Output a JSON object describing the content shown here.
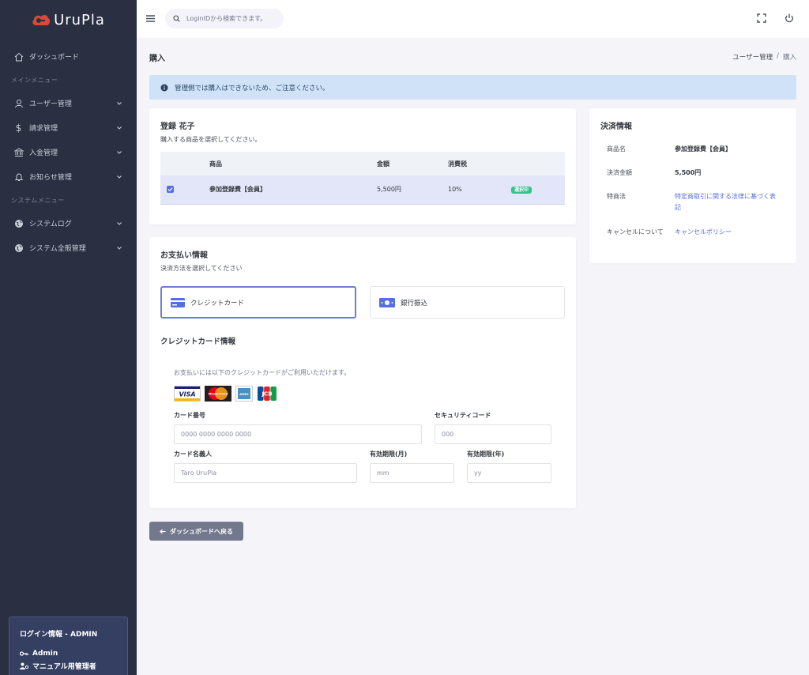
{
  "app": {
    "name": "UruPla",
    "brand_color": "#e0463a",
    "accent_color": "#556ee6"
  },
  "sidebar": {
    "dashboard": "ダッシュボード",
    "main_menu_label": "メインメニュー",
    "main_items": [
      {
        "label": "ユーザー管理",
        "icon": "user-icon"
      },
      {
        "label": "請求管理",
        "icon": "dollar-icon"
      },
      {
        "label": "入金管理",
        "icon": "bank-icon"
      },
      {
        "label": "お知らせ管理",
        "icon": "bell-icon"
      }
    ],
    "system_menu_label": "システムメニュー",
    "system_items": [
      {
        "label": "システムログ",
        "icon": "globe-icon"
      },
      {
        "label": "システム全般管理",
        "icon": "globe-icon"
      }
    ],
    "login_info": {
      "title": "ログイン情報 - ADMIN",
      "user": "Admin",
      "role": "マニュアル用管理者"
    }
  },
  "topbar": {
    "search_placeholder": "LoginIDから検索できます。"
  },
  "page": {
    "title": "購入",
    "breadcrumb": [
      "ユーザー管理",
      "購入"
    ],
    "alert": "管理側では購入はできないため、ご注意ください。"
  },
  "product_card": {
    "customer_name": "登録 花子",
    "instruction": "購入する商品を選択してください。",
    "columns": [
      "商品",
      "金額",
      "消費税"
    ],
    "rows": [
      {
        "product": "参加登録費【会員】",
        "price": "5,500円",
        "tax": "10%",
        "badge": "選択中",
        "checked": true
      }
    ]
  },
  "payment_card": {
    "title": "お支払い情報",
    "instruction": "決済方法を選択してください",
    "options": [
      {
        "label": "クレジットカード",
        "selected": true
      },
      {
        "label": "銀行振込",
        "selected": false
      }
    ],
    "cc_title": "クレジットカード情報",
    "cc_note": "お支払いには以下のクレジットカードがご利用いただけます。",
    "card_brands": [
      "VISA",
      "MasterCard",
      "AMEX",
      "JCB"
    ],
    "fields": {
      "card_number": {
        "label": "カード番号",
        "placeholder": "0000 0000 0000 0000"
      },
      "security_code": {
        "label": "セキュリティコード",
        "placeholder": "000"
      },
      "holder_name": {
        "label": "カード名義人",
        "placeholder": "Taro UruPla"
      },
      "exp_month": {
        "label": "有効期限(月)",
        "placeholder": "mm"
      },
      "exp_year": {
        "label": "有効期限(年)",
        "placeholder": "yy"
      }
    }
  },
  "settlement": {
    "title": "決済情報",
    "rows": [
      {
        "key": "商品名",
        "value": "参加登録費【会員】"
      },
      {
        "key": "決済金額",
        "value": "5,500円"
      },
      {
        "key": "特商法",
        "value": "特定商取引に関する法律に基づく表記"
      },
      {
        "key": "キャンセルについて",
        "value": "キャンセルポリシー"
      }
    ]
  },
  "back_button": "ダッシュボードへ戻る"
}
